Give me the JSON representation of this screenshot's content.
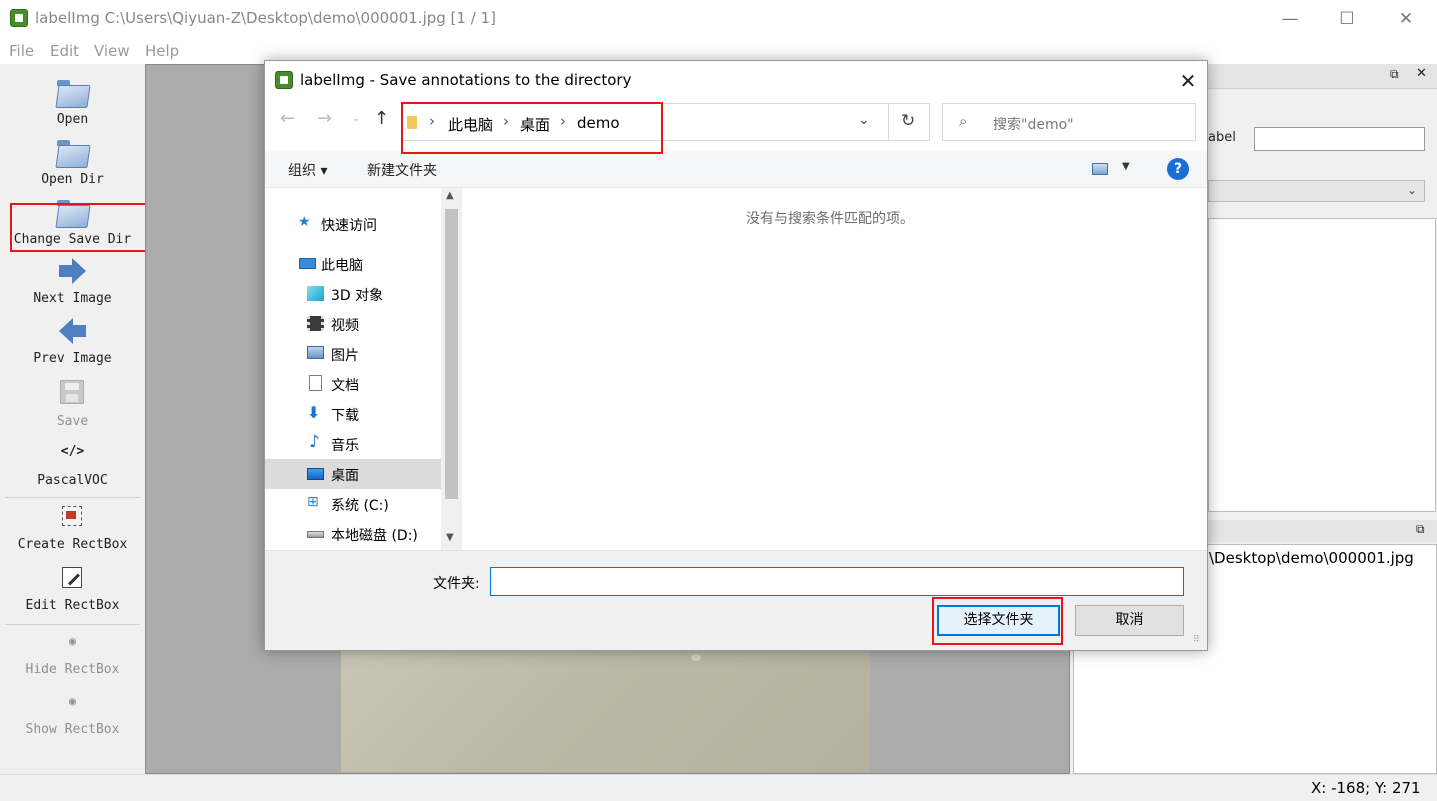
{
  "main_window": {
    "title": "labelImg C:\\Users\\Qiyuan-Z\\Desktop\\demo\\000001.jpg [1 / 1]",
    "controls": {
      "minimize": "—",
      "maximize": "☐",
      "close": "✕"
    }
  },
  "menu": [
    "File",
    "Edit",
    "View",
    "Help"
  ],
  "toolbar": {
    "open": "Open",
    "open_dir": "Open Dir",
    "change_save_dir": "Change Save Dir",
    "next_image": "Next Image",
    "prev_image": "Prev Image",
    "save": "Save",
    "format_icon": "</>",
    "format": "PascalVOC",
    "create_rectbox": "Create RectBox",
    "edit_rectbox": "Edit RectBox",
    "hide_rectbox": "Hide RectBox",
    "show_rectbox": "Show RectBox"
  },
  "right_panel": {
    "label_text": "abel",
    "file_path": "\\Desktop\\demo\\000001.jpg"
  },
  "status_bar": {
    "coords": "X: -168; Y: 271"
  },
  "dialog": {
    "title": "labelImg - Save annotations to the directory",
    "breadcrumbs": [
      "此电脑",
      "桌面",
      "demo"
    ],
    "search_placeholder": "搜索\"demo\"",
    "organize": "组织 ▾",
    "new_folder": "新建文件夹",
    "help_icon": "?",
    "nav": {
      "quick_access": "快速访问",
      "this_pc": "此电脑",
      "objects_3d": "3D 对象",
      "videos": "视频",
      "pictures": "图片",
      "documents": "文档",
      "downloads": "下载",
      "music": "音乐",
      "desktop": "桌面",
      "drive_c": "系统 (C:)",
      "drive_d": "本地磁盘 (D:)"
    },
    "empty_message": "没有与搜索条件匹配的项。",
    "folder_label": "文件夹:",
    "folder_value": "",
    "select_button": "选择文件夹",
    "cancel_button": "取消"
  },
  "colors": {
    "highlight_red": "#e8141a",
    "accent_blue": "#0078d7",
    "selected_nav": "#dcdcdc"
  }
}
